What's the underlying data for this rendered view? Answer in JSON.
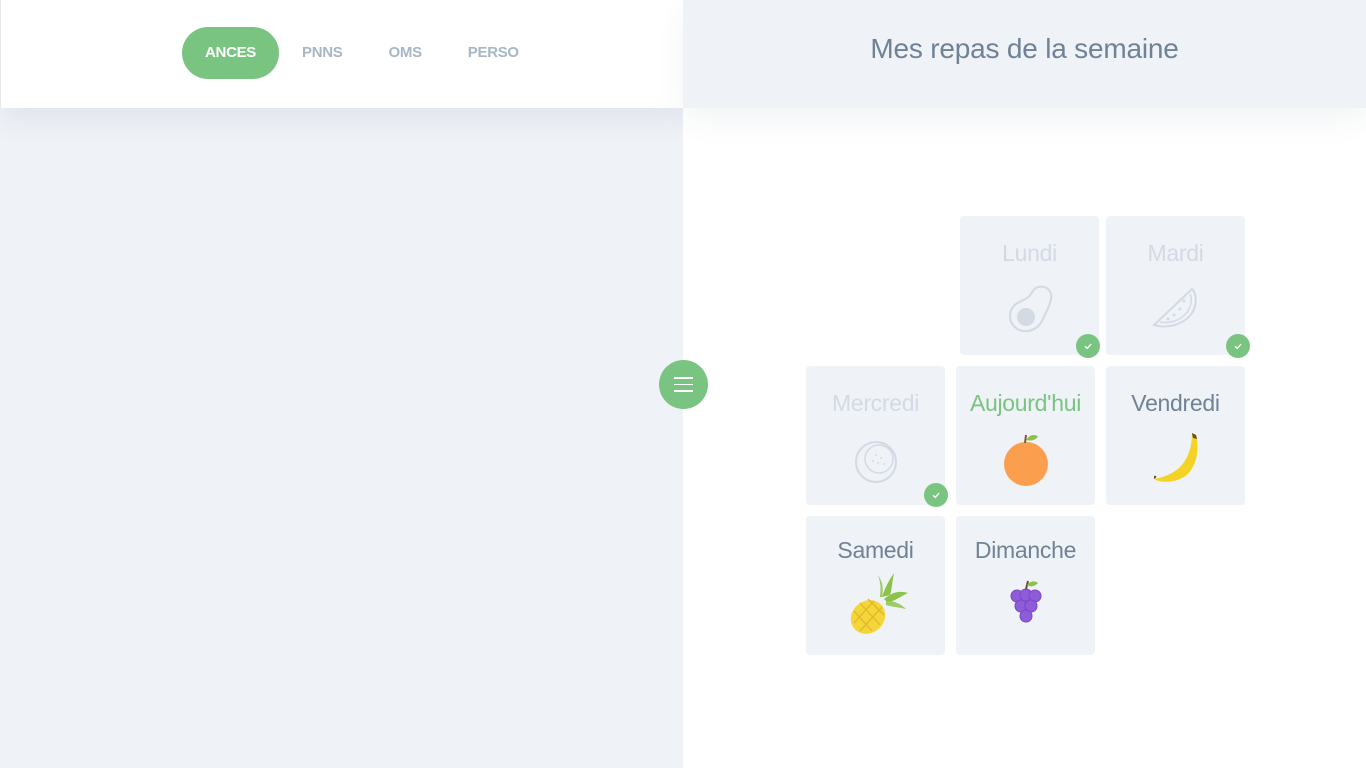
{
  "tabs": [
    {
      "label": "ANCES",
      "active": true
    },
    {
      "label": "PNNS",
      "active": false
    },
    {
      "label": "OMS",
      "active": false
    },
    {
      "label": "PERSO",
      "active": false
    }
  ],
  "header": {
    "title": "Mes repas de la semaine"
  },
  "menu_button": {
    "icon": "hamburger-menu-icon"
  },
  "days": [
    {
      "name": "Lundi",
      "fruit": "avocado-icon",
      "done": true,
      "state": "past"
    },
    {
      "name": "Mardi",
      "fruit": "watermelon-icon",
      "done": true,
      "state": "past"
    },
    {
      "name": "Mercredi",
      "fruit": "coconut-icon",
      "done": true,
      "state": "past"
    },
    {
      "name": "Aujourd'hui",
      "fruit": "orange-icon",
      "done": false,
      "state": "today"
    },
    {
      "name": "Vendredi",
      "fruit": "banana-icon",
      "done": false,
      "state": "upcoming"
    },
    {
      "name": "Samedi",
      "fruit": "pineapple-icon",
      "done": false,
      "state": "upcoming"
    },
    {
      "name": "Dimanche",
      "fruit": "grapes-icon",
      "done": false,
      "state": "upcoming"
    }
  ],
  "colors": {
    "accent": "#7ac482",
    "panel": "#eff2f7",
    "text": "#6f8296",
    "muted": "#a8b6c5",
    "past": "#d3dae4"
  }
}
